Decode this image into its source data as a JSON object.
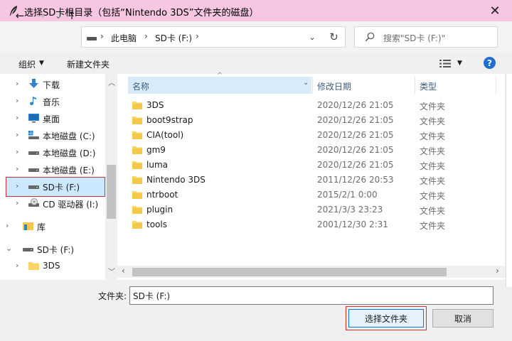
{
  "dialog": {
    "title": "选择SD卡根目录（包括“Nintendo 3DS”文件夹的磁盘）",
    "close_glyph": "✕"
  },
  "nav": {
    "back": "←",
    "forward": "→",
    "dropdown": "⌄",
    "up": "↑",
    "breadcrumb": [
      "此电脑",
      "SD卡 (F:)"
    ],
    "breadcrumb_sep": "›",
    "address_dropdown": "⌄",
    "refresh": "↻",
    "search_placeholder": "搜索\"SD卡 (F:)\""
  },
  "toolbar": {
    "organize": "组织",
    "organize_dd": "▼",
    "new_folder": "新建文件夹",
    "view_dd": "▼",
    "help": "?"
  },
  "sidebar": {
    "items": [
      {
        "label": "下载",
        "icon": "download-icon",
        "chevron": "›"
      },
      {
        "label": "音乐",
        "icon": "music-icon",
        "chevron": "›"
      },
      {
        "label": "桌面",
        "icon": "desktop-icon",
        "chevron": "›"
      },
      {
        "label": "本地磁盘 (C:)",
        "icon": "windows-drive-icon",
        "chevron": "›"
      },
      {
        "label": "本地磁盘 (D:)",
        "icon": "drive-icon",
        "chevron": "›"
      },
      {
        "label": "本地磁盘 (E:)",
        "icon": "drive-icon",
        "chevron": "›"
      },
      {
        "label": "SD卡 (F:)",
        "icon": "drive-icon",
        "chevron": "›",
        "selected": true
      },
      {
        "label": "CD 驱动器 (I:)",
        "icon": "cd-drive-icon",
        "chevron": "›"
      },
      {
        "label": "库",
        "icon": "library-icon",
        "chevron": "›"
      },
      {
        "label": "SD卡 (F:)",
        "icon": "drive-icon",
        "chevron": "⌄"
      },
      {
        "label": "3DS",
        "icon": "folder-icon",
        "chevron": "›"
      }
    ],
    "scroll_up": "︿",
    "scroll_down": "﹀"
  },
  "columns": {
    "name": "名称",
    "date": "修改日期",
    "type": "类型",
    "sort_indicator": "^"
  },
  "files": [
    {
      "name": "3DS",
      "date": "2020/12/26 21:05",
      "type": "文件夹"
    },
    {
      "name": "boot9strap",
      "date": "2020/12/26 21:05",
      "type": "文件夹"
    },
    {
      "name": "CIA(tool)",
      "date": "2020/12/26 21:05",
      "type": "文件夹"
    },
    {
      "name": "gm9",
      "date": "2020/12/26 21:05",
      "type": "文件夹"
    },
    {
      "name": "luma",
      "date": "2020/12/26 21:05",
      "type": "文件夹"
    },
    {
      "name": "Nintendo 3DS",
      "date": "2011/12/26 20:53",
      "type": "文件夹"
    },
    {
      "name": "ntrboot",
      "date": "2015/2/1 0:00",
      "type": "文件夹"
    },
    {
      "name": "plugin",
      "date": "2021/3/3 23:23",
      "type": "文件夹"
    },
    {
      "name": "tools",
      "date": "2001/12/30 2:31",
      "type": "文件夹"
    }
  ],
  "hscroll": {
    "left": "‹",
    "right": "›"
  },
  "footer": {
    "folder_label": "文件夹:",
    "folder_value": "SD卡 (F:)",
    "select_button": "选择文件夹",
    "cancel_button": "取消"
  },
  "colors": {
    "titlebar": "#f7c6e2",
    "accent": "#0078d7",
    "highlight_border": "#d23030",
    "selection": "#cce8ff",
    "folder": "#ffd466"
  }
}
